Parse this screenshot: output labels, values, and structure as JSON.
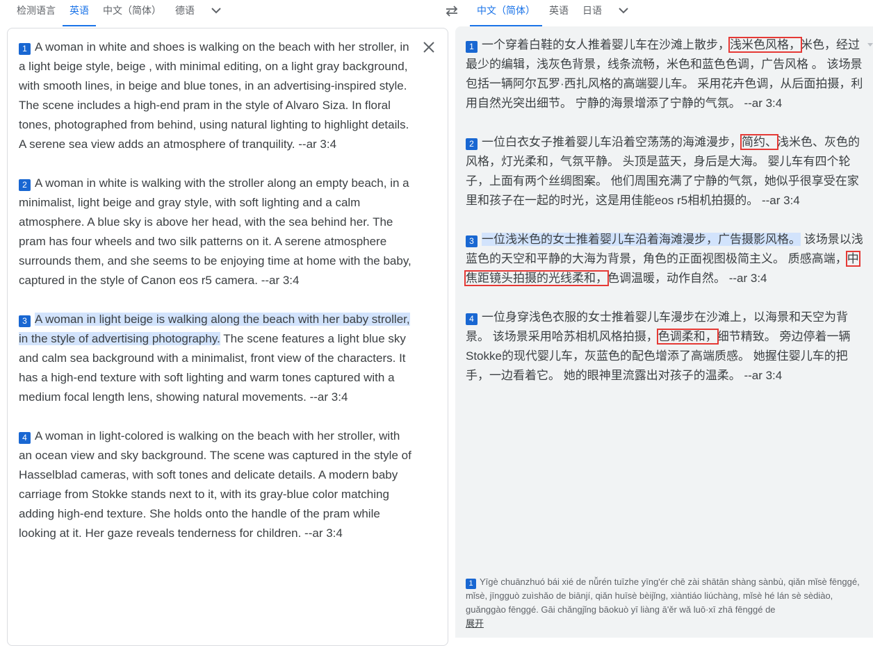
{
  "source_langs": {
    "tabs": [
      "检测语言",
      "英语",
      "中文（简体）",
      "德语"
    ],
    "active_index": 1
  },
  "target_langs": {
    "tabs": [
      "中文（简体）",
      "英语",
      "日语"
    ],
    "active_index": 0
  },
  "source": {
    "paragraphs": [
      {
        "num": "1",
        "segments": [
          {
            "text": "A woman in white and shoes is walking on the beach with her stroller, in a light beige style, beige , with minimal editing, on a light gray background, with smooth lines, in beige and blue tones, in an advertising-inspired style. The scene includes a high-end pram in the style of Alvaro Siza. In floral tones, photographed from behind, using natural lighting to highlight details. A serene sea view adds an atmosphere of tranquility. --ar 3:4"
          }
        ]
      },
      {
        "num": "2",
        "segments": [
          {
            "text": "A woman in white is walking with the stroller along an empty beach, in a minimalist, light beige and gray style, with soft lighting and a calm atmosphere. A blue sky is above her head, with the sea behind her. The pram has four wheels and two silk patterns on it. A serene atmosphere surrounds them, and she seems to be enjoying time at home with the baby, captured in the style of Canon eos r5 camera. --ar 3:4"
          }
        ]
      },
      {
        "num": "3",
        "segments": [
          {
            "text": "A woman in light beige is walking along the beach with her baby stroller, in the style of advertising photography.",
            "highlight": true
          },
          {
            "text": " The scene features a light blue sky and calm sea background with a minimalist, front view of the characters. It has a high-end texture with soft lighting and warm tones captured with a medium focal length lens, showing natural movements. --ar 3:4"
          }
        ]
      },
      {
        "num": "4",
        "segments": [
          {
            "text": "A woman in light-colored is walking on the beach with her stroller, with an ocean view and sky background. The scene was captured in the style of Hasselblad cameras, with soft tones and delicate details. A modern baby carriage from Stokke stands next to it, with its gray-blue color matching adding high-end texture. She holds onto the handle of the pram while looking at it. Her gaze reveals tenderness for children. --ar 3:4"
          }
        ]
      }
    ]
  },
  "target": {
    "paragraphs": [
      {
        "num": "1",
        "segments": [
          {
            "text": "一个穿着白鞋的女人推着婴儿车在沙滩上散步，"
          },
          {
            "text": "浅米色风格，",
            "boxed": true
          },
          {
            "text": "米色，经过最少的编辑，浅灰色背景，线条流畅，米色和蓝色色调，广告风格 。 该场景包括一辆阿尔瓦罗·西扎风格的高端婴儿车。 采用花卉色调，从后面拍摄，利用自然光突出细节。 宁静的海景增添了宁静的气氛。 --ar 3:4"
          }
        ]
      },
      {
        "num": "2",
        "segments": [
          {
            "text": "一位白衣女子推着婴儿车沿着空荡荡的海滩漫步，"
          },
          {
            "text": "简约、",
            "boxed": true
          },
          {
            "text": "浅米色、灰色的风格，灯光柔和，气氛平静。 头顶是蓝天，身后是大海。 婴儿车有四个轮子，上面有两个丝绸图案。 他们周围充满了宁静的气氛，她似乎很享受在家里和孩子在一起的时光，这是用佳能eos r5相机拍摄的。 --ar 3:4"
          }
        ]
      },
      {
        "num": "3",
        "segments": [
          {
            "text": "一位浅米色的女士推着婴儿车沿着海滩漫步，广告摄影风格。",
            "highlight": true
          },
          {
            "text": " 该场景以浅蓝色的天空和平静的大海为背景，角色的正面视图极简主义。 质感高端，"
          },
          {
            "text": "中焦距镜头拍摄的光线柔和，",
            "boxed": true
          },
          {
            "text": "色调温暖，动作自然。 --ar 3:4"
          }
        ]
      },
      {
        "num": "4",
        "segments": [
          {
            "text": "一位身穿浅色衣服的女士推着婴儿车漫步在沙滩上，以海景和天空为背景。 该场景采用哈苏相机风格拍摄，"
          },
          {
            "text": "色调柔和，",
            "boxed": true
          },
          {
            "text": "细节精致。 旁边停着一辆Stokke的现代婴儿车，灰蓝色的配色增添了高端质感。 她握住婴儿车的把手，一边看着它。 她的眼神里流露出对孩子的温柔。 --ar 3:4"
          }
        ]
      }
    ]
  },
  "transliteration": {
    "num": "1",
    "text": "Yīgè chuānzhuó bái xié de nǚrén tuīzhe yīng'ér chē zài shātān shàng sànbù, qiǎn mǐsè fēnggé, mǐsè, jīngguò zuìshǎo de biānjí, qiǎn huīsè bèijǐng, xiàntiáo liúchàng, mǐsè hé lán sè sèdiào, guǎnggào fēnggé. Gāi chǎngjǐng bāokuò yī liàng ā'ěr wǎ luō·xī zhā fēnggé de",
    "expand_label": "展开"
  },
  "icons": {
    "swap": "swap-arrows-icon",
    "close": "close-icon",
    "chevron": "chevron-down-icon"
  },
  "colors": {
    "accent": "#1a73e8",
    "number_badge": "#1967d2",
    "highlight": "#d2e3fc",
    "box_outline": "#e53935",
    "target_bg": "#f1f3f4"
  }
}
